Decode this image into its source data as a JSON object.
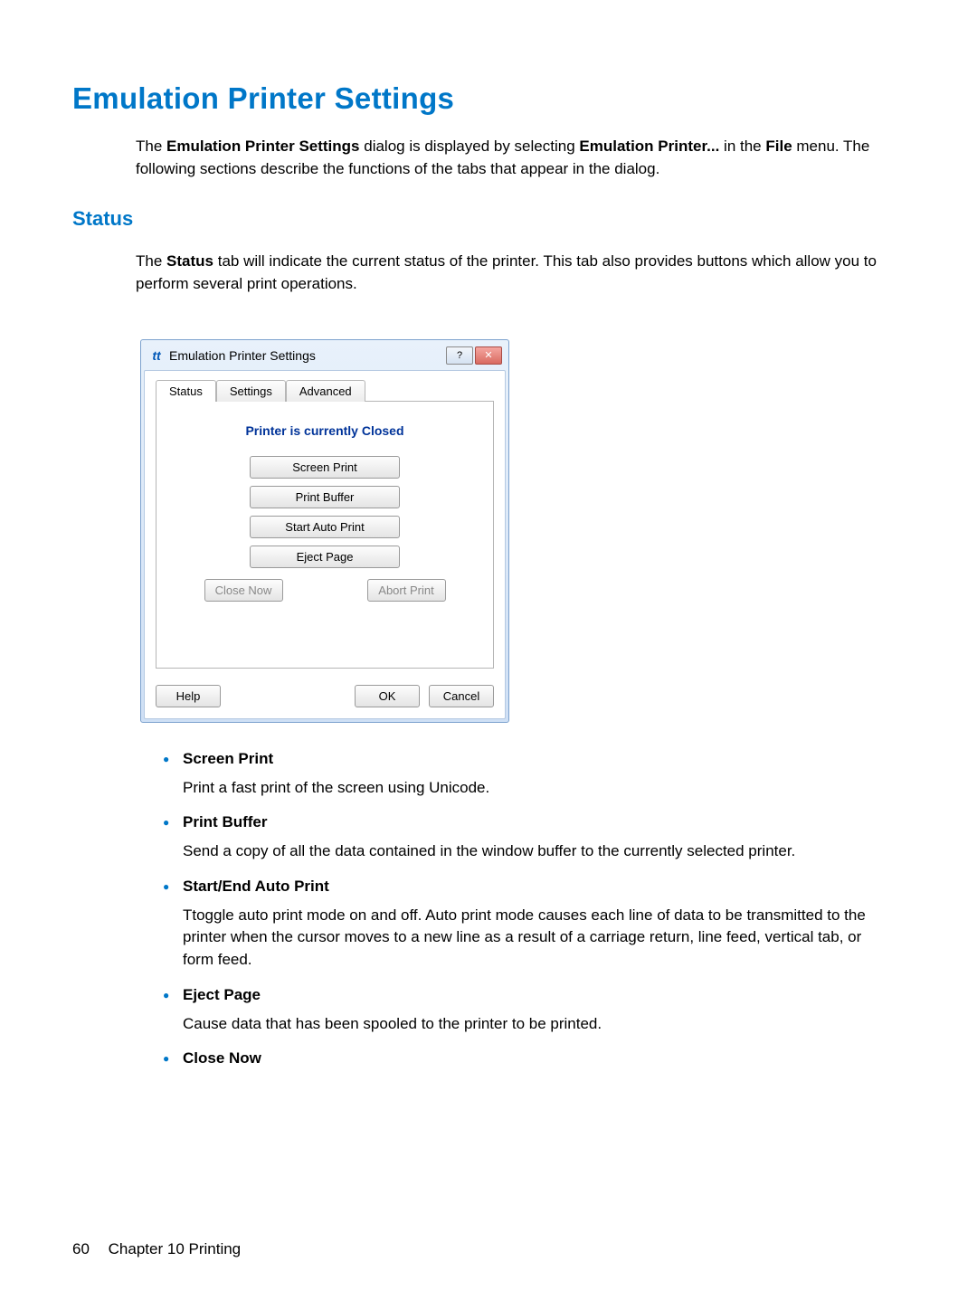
{
  "headings": {
    "h1": "Emulation Printer Settings",
    "h2": "Status"
  },
  "intro": {
    "p1_a": "The ",
    "p1_b": "Emulation Printer Settings",
    "p1_c": " dialog is displayed by selecting ",
    "p1_d": "Emulation Printer...",
    "p1_e": " in the ",
    "p1_f": "File",
    "p1_g": " menu. The following sections describe the functions of the tabs that appear in the dialog."
  },
  "status_intro": {
    "a": "The ",
    "b": "Status",
    "c": " tab will indicate the current status of the printer. This tab also provides buttons which allow you to perform several print operations."
  },
  "dialog": {
    "icon_text": "tt",
    "title": "Emulation Printer Settings",
    "help_symbol": "?",
    "close_symbol": "✕",
    "tabs": {
      "status": "Status",
      "settings": "Settings",
      "advanced": "Advanced"
    },
    "status_message": "Printer is currently Closed",
    "buttons": {
      "screen_print": "Screen Print",
      "print_buffer": "Print Buffer",
      "start_auto": "Start Auto Print",
      "eject_page": "Eject Page",
      "close_now": "Close Now",
      "abort_print": "Abort Print",
      "help": "Help",
      "ok": "OK",
      "cancel": "Cancel"
    }
  },
  "features": [
    {
      "title": "Screen Print",
      "desc": "Print a fast print of the screen using Unicode."
    },
    {
      "title": "Print Buffer",
      "desc": "Send a copy of all the data contained in the window buffer to the currently selected printer."
    },
    {
      "title": "Start/End Auto Print",
      "desc": "Ttoggle auto print mode on and off. Auto print mode causes each line of data to be transmitted to the printer when the cursor moves to a new line as a result of a carriage return, line feed, vertical tab, or form feed."
    },
    {
      "title": "Eject Page",
      "desc": "Cause data that has been spooled to the printer to be printed."
    },
    {
      "title": "Close Now",
      "desc": ""
    }
  ],
  "footer": {
    "page_no": "60",
    "chapter": "Chapter 10   Printing"
  }
}
